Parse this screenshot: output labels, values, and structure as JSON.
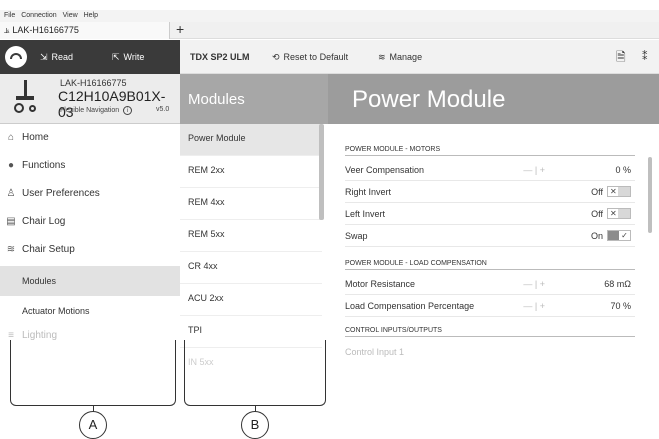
{
  "menubar": {
    "items": [
      "File",
      "Connection",
      "View",
      "Help"
    ]
  },
  "tab": {
    "title": "LAK-H16166775",
    "add": "+"
  },
  "toolbar_left": {
    "read_label": "Read",
    "write_label": "Write"
  },
  "toolbar_right": {
    "product": "TDX SP2 ULM",
    "reset_label": "Reset to Default",
    "manage_label": "Manage"
  },
  "chair": {
    "serial": "LAK-H16166775",
    "model": "C12H10A9B01X-03",
    "nav": "Flexible Navigation",
    "version": "v5.0"
  },
  "headers": {
    "modules": "Modules",
    "page": "Power Module"
  },
  "sidebar": {
    "items": [
      {
        "label": "Home",
        "icon": "home-icon",
        "glyph": "⌂"
      },
      {
        "label": "Functions",
        "icon": "functions-icon",
        "glyph": "●"
      },
      {
        "label": "User Preferences",
        "icon": "user-icon",
        "glyph": "♙"
      },
      {
        "label": "Chair Log",
        "icon": "log-icon",
        "glyph": "▤"
      },
      {
        "label": "Chair Setup",
        "icon": "setup-icon",
        "glyph": "≋"
      }
    ],
    "subitems": [
      "Modules",
      "Actuator Motions"
    ],
    "lighting": {
      "label": "Lighting",
      "icon": "lighting-icon",
      "glyph": "≡"
    }
  },
  "modules": [
    "Power Module",
    "REM 2xx",
    "REM 4xx",
    "REM 5xx",
    "CR 4xx",
    "ACU 2xx",
    "TPI",
    "IN 5xx"
  ],
  "content": {
    "section1": "POWER MODULE - MOTORS",
    "rows1": [
      {
        "label": "Veer Compensation",
        "value": "0 %"
      },
      {
        "label": "Right Invert",
        "state": "Off"
      },
      {
        "label": "Left Invert",
        "state": "Off"
      },
      {
        "label": "Swap",
        "state": "On"
      }
    ],
    "section2": "POWER MODULE - LOAD COMPENSATION",
    "rows2": [
      {
        "label": "Motor Resistance",
        "value": "68 mΩ"
      },
      {
        "label": "Load Compensation Percentage",
        "value": "70 %"
      }
    ],
    "section3": "CONTROL INPUTS/OUTPUTS",
    "rows3": [
      {
        "label": "Control Input 1"
      }
    ]
  },
  "callouts": {
    "a": "A",
    "b": "B"
  },
  "colors": {
    "dark_toolbar": "#3a3a3a",
    "modules_header": "#a7a7a7",
    "page_header": "#9c9c9c",
    "active_sub": "#e2e2e2"
  }
}
